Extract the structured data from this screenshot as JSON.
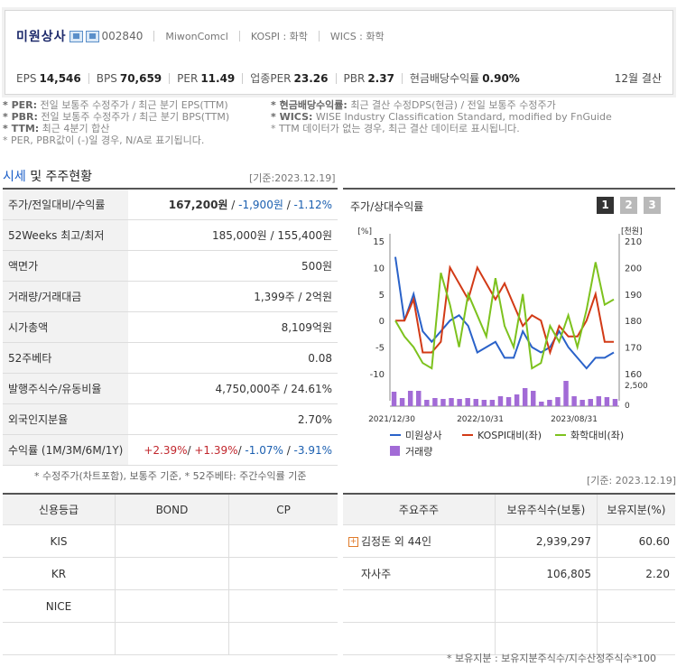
{
  "company": {
    "name": "미원상사",
    "code": "002840",
    "eng_name": "MiwonComcl",
    "market": "KOSPI : 화학",
    "wics": "WICS : 화학"
  },
  "metrics": [
    {
      "label": "EPS",
      "value": "14,546"
    },
    {
      "label": "BPS",
      "value": "70,659"
    },
    {
      "label": "PER",
      "value": "11.49"
    },
    {
      "label": "업종PER",
      "value": "23.26"
    },
    {
      "label": "PBR",
      "value": "2.37"
    },
    {
      "label": "현금배당수익률",
      "value": "0.90%"
    }
  ],
  "fiscal": "12월 결산",
  "notes_left": [
    {
      "key": "* PER:",
      "text": " 전일 보통주 수정주가 / 최근 분기 EPS(TTM)"
    },
    {
      "key": "* PBR:",
      "text": " 전일 보통주 수정주가 / 최근 분기 BPS(TTM)"
    },
    {
      "key": "* TTM:",
      "text": " 최근 4분기 합산"
    },
    {
      "key": "",
      "text": "* PER, PBR값이 (-)일 경우, N/A로 표기됩니다."
    }
  ],
  "notes_right": [
    {
      "key": "* 현금배당수익률:",
      "text": " 최근 결산 수정DPS(현금) / 전일 보통주 수정주가"
    },
    {
      "key": "* WICS:",
      "text": " WISE Industry Classification Standard, modified by FnGuide"
    },
    {
      "key": "",
      "text": "* TTM 데이터가 없는 경우, 최근 결산 데이터로 표시됩니다."
    }
  ],
  "section": {
    "title_a": "시세",
    "title_b": " 및 주주현황",
    "date": "[기준:2023.12.19]"
  },
  "price_table": [
    {
      "label": "주가/전일대비/수익률",
      "v1": "167,200원",
      "v2": " / ",
      "v3": "-1,900원",
      "v4": " / ",
      "v5": "-1.12%"
    },
    {
      "label": "52Weeks 최고/최저",
      "value": "185,000원 / 155,400원"
    },
    {
      "label": "액면가",
      "value": "500원"
    },
    {
      "label": "거래량/거래대금",
      "value": "1,399주 / 2억원"
    },
    {
      "label": "시가총액",
      "value": "8,109억원"
    },
    {
      "label": "52주베타",
      "value": "0.08"
    },
    {
      "label": "발행주식수/유동비율",
      "value": "4,750,000주 / 24.61%"
    },
    {
      "label": "외국인지분율",
      "value": "2.70%"
    },
    {
      "label": "수익률 (1M/3M/6M/1Y)",
      "r1": "+2.39%",
      "r2": "+1.39%",
      "r3": "-1.07%",
      "r4": "-3.91%"
    }
  ],
  "price_note": "* 수정주가(차트포함), 보통주 기준, * 52주베타: 주간수익률 기준",
  "chart": {
    "title": "주가/상대수익률",
    "pages": [
      "1",
      "2",
      "3"
    ],
    "active_color": "#333333",
    "inactive_color": "#b9b9b9"
  },
  "chart_data": {
    "type": "line",
    "left_unit": "[%]",
    "right_unit": "[천원]",
    "left_ticks": [
      "15",
      "10",
      "5",
      "0",
      "-5",
      "-10"
    ],
    "right_ticks": [
      "210",
      "200",
      "190",
      "180",
      "170",
      "160"
    ],
    "left_ylim": [
      -10,
      15
    ],
    "right_ylim": [
      160,
      210
    ],
    "volume_tick": "2,500",
    "volume_zero": "0",
    "x_ticks": [
      "2021/12/30",
      "2022/10/31",
      "2023/08/31"
    ],
    "series": [
      {
        "name": "미원상사",
        "color": "#2a62c9",
        "axis": "left",
        "values": [
          12,
          0,
          5,
          -2,
          -4,
          -2,
          0,
          1,
          -1,
          -6,
          -5,
          -4,
          -7,
          -7,
          -2,
          -5,
          -6,
          -5,
          -2,
          -5,
          -7,
          -9,
          -7,
          -7,
          -6
        ]
      },
      {
        "name": "KOSPI대비(좌)",
        "color": "#d23a16",
        "axis": "left",
        "values": [
          0,
          0,
          4,
          -6,
          -6,
          -4,
          10,
          7,
          4,
          10,
          7,
          4,
          7,
          3,
          -1,
          1,
          0,
          -6,
          -1,
          -3,
          -3,
          0,
          5,
          -4,
          -4
        ]
      },
      {
        "name": "화학대비(좌)",
        "color": "#7dc21e",
        "axis": "left",
        "values": [
          0,
          -3,
          -5,
          -8,
          -9,
          9,
          3,
          -5,
          5,
          1,
          -3,
          8,
          -1,
          -5,
          5,
          -9,
          -8,
          -1,
          -4,
          1,
          -5,
          2,
          11,
          3,
          4
        ]
      },
      {
        "name": "거래량",
        "color": "#a26bd6",
        "axis": "volume",
        "values": [
          1600,
          900,
          1700,
          1700,
          700,
          900,
          800,
          900,
          800,
          900,
          800,
          700,
          700,
          1100,
          1000,
          1300,
          2000,
          1700,
          500,
          700,
          1000,
          2800,
          1100,
          700,
          800,
          1100,
          1000,
          800
        ]
      }
    ]
  },
  "credit": {
    "headers": [
      "신용등급",
      "BOND",
      "CP"
    ],
    "rows": [
      [
        "KIS",
        "",
        ""
      ],
      [
        "KR",
        "",
        ""
      ],
      [
        "NICE",
        "",
        ""
      ],
      [
        "",
        "",
        ""
      ]
    ]
  },
  "shareholders": {
    "date": "[기준: 2023.12.19]",
    "headers": [
      "주요주주",
      "보유주식수(보통)",
      "보유지분(%)"
    ],
    "rows": [
      {
        "name": "김정돈 외 44인",
        "shares": "2,939,297",
        "pct": "60.60",
        "expandable": true
      },
      {
        "name": "자사주",
        "shares": "106,805",
        "pct": "2.20",
        "expandable": false
      },
      {
        "name": "",
        "shares": "",
        "pct": "",
        "expandable": false
      },
      {
        "name": "",
        "shares": "",
        "pct": "",
        "expandable": false
      }
    ],
    "note": "* 보유지분 : 보유지분주식수/지수산정주식수*100"
  }
}
